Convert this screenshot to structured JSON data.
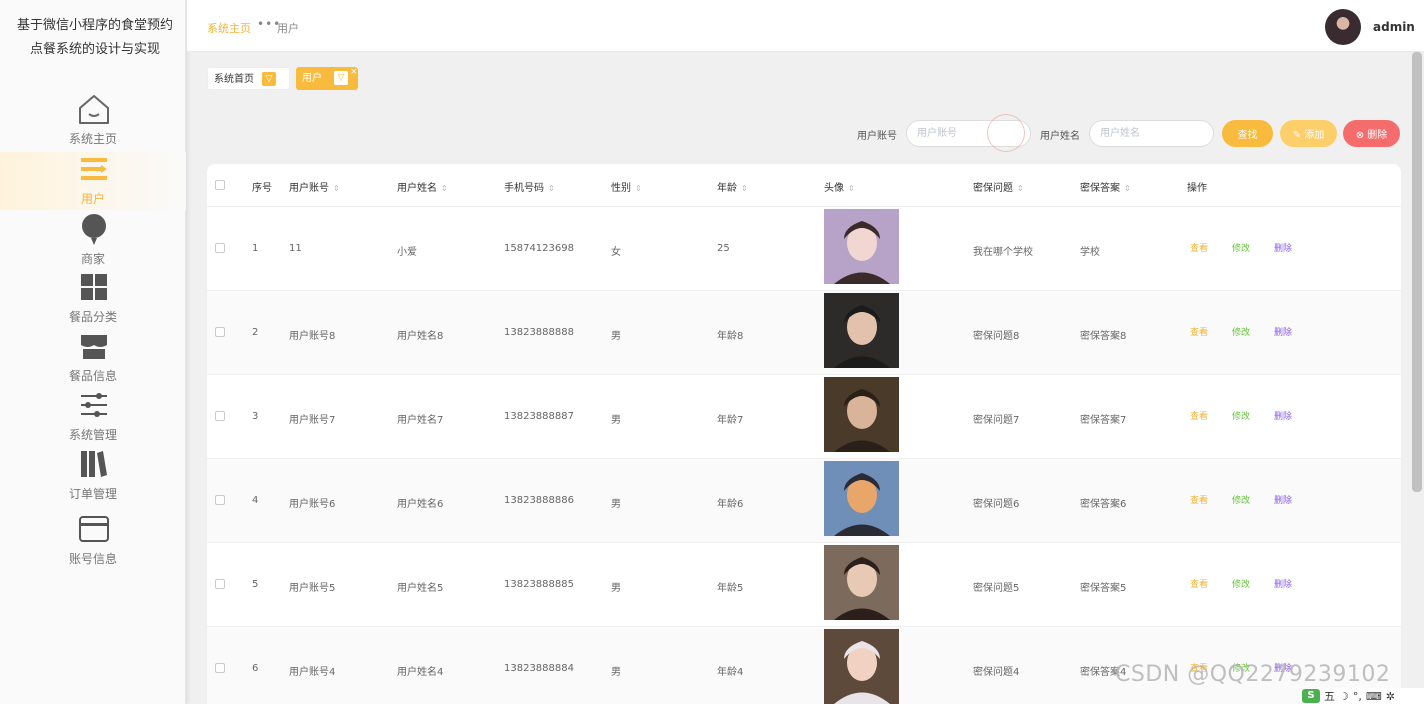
{
  "sidebar": {
    "title": "基于微信小程序的食堂预约点餐系统的设计与实现",
    "items": [
      {
        "label": "系统主页",
        "icon": "home-icon"
      },
      {
        "label": "用户",
        "icon": "user-list-icon"
      },
      {
        "label": "商家",
        "icon": "bulb-icon"
      },
      {
        "label": "餐品分类",
        "icon": "grid-icon"
      },
      {
        "label": "餐品信息",
        "icon": "store-icon"
      },
      {
        "label": "系统管理",
        "icon": "sliders-icon"
      },
      {
        "label": "订单管理",
        "icon": "books-icon"
      },
      {
        "label": "账号信息",
        "icon": "card-icon"
      }
    ]
  },
  "header": {
    "breadcrumb_home": "系统主页",
    "breadcrumb_sep": "•••",
    "breadcrumb_current": "用户",
    "username": "admin"
  },
  "tags": {
    "home": "系统首页",
    "current": "用户",
    "close": "×"
  },
  "search": {
    "account_label": "用户账号",
    "account_placeholder": "用户账号",
    "name_label": "用户姓名",
    "name_placeholder": "用户姓名",
    "search_btn": "查找",
    "add_btn": "添加",
    "delete_btn": "删除"
  },
  "table": {
    "headers": [
      "序号",
      "用户账号",
      "用户姓名",
      "手机号码",
      "性别",
      "年龄",
      "头像",
      "密保问题",
      "密保答案",
      "操作"
    ],
    "rows": [
      {
        "no": "1",
        "account": "11",
        "name": "小爱",
        "phone": "15874123698",
        "gender": "女",
        "age": "25",
        "question": "我在哪个学校",
        "answer": "学校"
      },
      {
        "no": "2",
        "account": "用户账号8",
        "name": "用户姓名8",
        "phone": "13823888888",
        "gender": "男",
        "age": "年龄8",
        "question": "密保问题8",
        "answer": "密保答案8"
      },
      {
        "no": "3",
        "account": "用户账号7",
        "name": "用户姓名7",
        "phone": "13823888887",
        "gender": "男",
        "age": "年龄7",
        "question": "密保问题7",
        "answer": "密保答案7"
      },
      {
        "no": "4",
        "account": "用户账号6",
        "name": "用户姓名6",
        "phone": "13823888886",
        "gender": "男",
        "age": "年龄6",
        "question": "密保问题6",
        "answer": "密保答案6"
      },
      {
        "no": "5",
        "account": "用户账号5",
        "name": "用户姓名5",
        "phone": "13823888885",
        "gender": "男",
        "age": "年龄5",
        "question": "密保问题5",
        "answer": "密保答案5"
      },
      {
        "no": "6",
        "account": "用户账号4",
        "name": "用户姓名4",
        "phone": "13823888884",
        "gender": "男",
        "age": "年龄4",
        "question": "密保问题4",
        "answer": "密保答案4"
      }
    ],
    "actions": {
      "view": "查看",
      "edit": "修改",
      "delete": "删除"
    }
  },
  "watermark": "CSDN @QQ2279239102",
  "tray": {
    "ime": "五",
    "logo": "S"
  },
  "colors": {
    "accent": "#f8bb3d",
    "danger": "#f56c6c",
    "edit": "#67c23a",
    "delete_link": "#8a5cf6"
  }
}
